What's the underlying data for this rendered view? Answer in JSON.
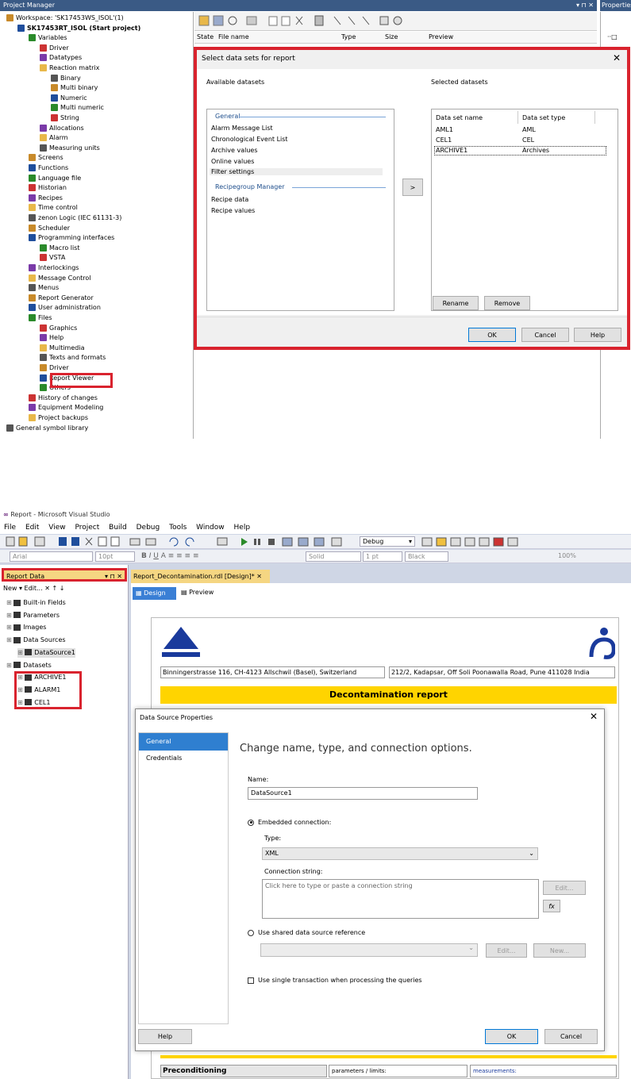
{
  "project_manager": {
    "title": "Project Manager",
    "window_controls": "▾ ⊓ ✕",
    "properties_title": "Properties",
    "tree": [
      {
        "label": "Workspace: 'SK17453WS_ISOL'(1)",
        "level": 0
      },
      {
        "label": "SK17453RT_ISOL (Start project)",
        "level": 1,
        "bold": true
      },
      {
        "label": "Variables",
        "level": 2
      },
      {
        "label": "Driver",
        "level": 3
      },
      {
        "label": "Datatypes",
        "level": 3
      },
      {
        "label": "Reaction matrix",
        "level": 3
      },
      {
        "label": "Binary",
        "level": 4
      },
      {
        "label": "Multi binary",
        "level": 4
      },
      {
        "label": "Numeric",
        "level": 4
      },
      {
        "label": "Multi numeric",
        "level": 4
      },
      {
        "label": "String",
        "level": 4
      },
      {
        "label": "Allocations",
        "level": 3
      },
      {
        "label": "Alarm",
        "level": 3
      },
      {
        "label": "Measuring units",
        "level": 3
      },
      {
        "label": "Screens",
        "level": 2
      },
      {
        "label": "Functions",
        "level": 2
      },
      {
        "label": "Language file",
        "level": 2
      },
      {
        "label": "Historian",
        "level": 2
      },
      {
        "label": "Recipes",
        "level": 2
      },
      {
        "label": "Time control",
        "level": 2
      },
      {
        "label": "zenon Logic (IEC 61131-3)",
        "level": 2
      },
      {
        "label": "Scheduler",
        "level": 2
      },
      {
        "label": "Programming interfaces",
        "level": 2
      },
      {
        "label": "Macro list",
        "level": 3
      },
      {
        "label": "VSTA",
        "level": 3
      },
      {
        "label": "Interlockings",
        "level": 2
      },
      {
        "label": "Message Control",
        "level": 2
      },
      {
        "label": "Menus",
        "level": 2
      },
      {
        "label": "Report Generator",
        "level": 2
      },
      {
        "label": "User administration",
        "level": 2
      },
      {
        "label": "Files",
        "level": 2
      },
      {
        "label": "Graphics",
        "level": 3
      },
      {
        "label": "Help",
        "level": 3
      },
      {
        "label": "Multimedia",
        "level": 3
      },
      {
        "label": "Texts and formats",
        "level": 3
      },
      {
        "label": "Driver",
        "level": 3
      },
      {
        "label": "Report Viewer",
        "level": 3
      },
      {
        "label": "Others",
        "level": 3
      },
      {
        "label": "History of changes",
        "level": 2
      },
      {
        "label": "Equipment Modeling",
        "level": 2
      },
      {
        "label": "Project backups",
        "level": 2
      },
      {
        "label": "General symbol library",
        "level": 0
      }
    ],
    "list_columns": [
      "State",
      "File name",
      "Type",
      "Size",
      "Preview"
    ]
  },
  "select_datasets_dialog": {
    "title": "Select data sets for report",
    "available_label": "Available datasets",
    "selected_label": "Selected datasets",
    "groups": [
      {
        "name": "General",
        "items": [
          "Alarm Message List",
          "Chronological Event List",
          "Archive values",
          "Online values",
          "Filter settings"
        ]
      },
      {
        "name": "Recipegroup Manager",
        "items": [
          "Recipe data",
          "Recipe values"
        ]
      }
    ],
    "selected_columns": [
      "Data set name",
      "Data set type"
    ],
    "selected_rows": [
      {
        "name": "AML1",
        "type": "AML"
      },
      {
        "name": "CEL1",
        "type": "CEL"
      },
      {
        "name": "ARCHIVE1",
        "type": "Archives"
      }
    ],
    "move_button": ">",
    "rename_button": "Rename",
    "remove_button": "Remove",
    "ok_button": "OK",
    "cancel_button": "Cancel",
    "help_button": "Help"
  },
  "visual_studio": {
    "title": "Report - Microsoft Visual Studio",
    "menu": [
      "File",
      "Edit",
      "View",
      "Project",
      "Build",
      "Debug",
      "Tools",
      "Window",
      "Help"
    ],
    "config": "Debug",
    "font": "Arial",
    "font_size": "10pt",
    "line_style": "Solid",
    "line_width": "1 pt",
    "color": "Black",
    "zoom": "100%",
    "report_data": {
      "title": "Report Data",
      "toolbar": "New ▾  Edit...  ✕  ↑  ↓",
      "nodes": [
        {
          "label": "Built-in Fields",
          "level": 0
        },
        {
          "label": "Parameters",
          "level": 0
        },
        {
          "label": "Images",
          "level": 0
        },
        {
          "label": "Data Sources",
          "level": 0
        },
        {
          "label": "DataSource1",
          "level": 1
        },
        {
          "label": "Datasets",
          "level": 0
        },
        {
          "label": "ARCHIVE1",
          "level": 1
        },
        {
          "label": "ALARM1",
          "level": 1
        },
        {
          "label": "CEL1",
          "level": 1
        }
      ]
    },
    "doc_tab": "Report_Decontamination.rdl [Design]*",
    "design_tab": "Design",
    "preview_tab": "Preview",
    "address_left": "Binningerstrasse 116, CH-4123 Allschwil (Basel), Switzerland",
    "address_right": "212/2, Kadapsar, Off Soli Poonawalla Road, Pune 411028 India",
    "report_title": "Decontamination report",
    "preconditioning": "Preconditioning",
    "parameters_limits": "parameters / limits:",
    "measurements": "measurements:"
  },
  "data_source_dialog": {
    "title": "Data Source Properties",
    "nav": [
      "General",
      "Credentials"
    ],
    "heading": "Change name, type, and connection options.",
    "name_label": "Name:",
    "name_value": "DataSource1",
    "embedded_label": "Embedded connection:",
    "type_label": "Type:",
    "type_value": "XML",
    "conn_label": "Connection string:",
    "conn_placeholder": "Click here to type or paste a connection string",
    "edit_button": "Edit...",
    "fx_button": "fx",
    "shared_label": "Use shared data source reference",
    "new_button": "New...",
    "single_tx_label": "Use single transaction when processing the queries",
    "help_button": "Help",
    "ok_button": "OK",
    "cancel_button": "Cancel"
  }
}
